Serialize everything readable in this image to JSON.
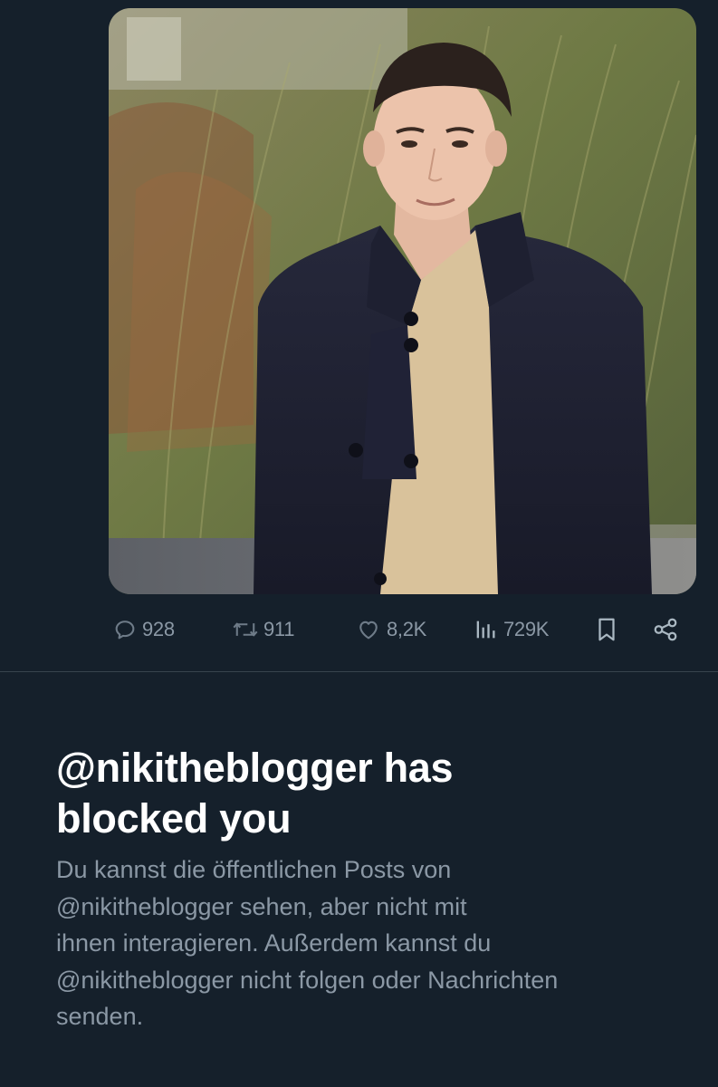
{
  "post": {
    "image": {
      "description": "photo",
      "icon": "photo-person-outdoors"
    },
    "actions": {
      "replies": {
        "icon": "reply-icon",
        "count": "928"
      },
      "reposts": {
        "icon": "repost-icon",
        "count": "911"
      },
      "likes": {
        "icon": "heart-icon",
        "count": "8,2K"
      },
      "views": {
        "icon": "views-icon",
        "count": "729K"
      },
      "bookmark": {
        "icon": "bookmark-icon"
      },
      "share": {
        "icon": "share-icon"
      }
    }
  },
  "block_notice": {
    "title": "@nikitheblogger has\nblocked you",
    "body": "Du kannst die öffentlichen Posts von\n@nikitheblogger sehen, aber nicht mit\nihnen interagieren. Außerdem kannst du\n@nikitheblogger nicht folgen oder Nachrichten\nsenden."
  },
  "colors": {
    "background": "#15202b",
    "divider": "#38444d",
    "secondary_text": "#8b98a5",
    "primary_text": "#ffffff"
  }
}
